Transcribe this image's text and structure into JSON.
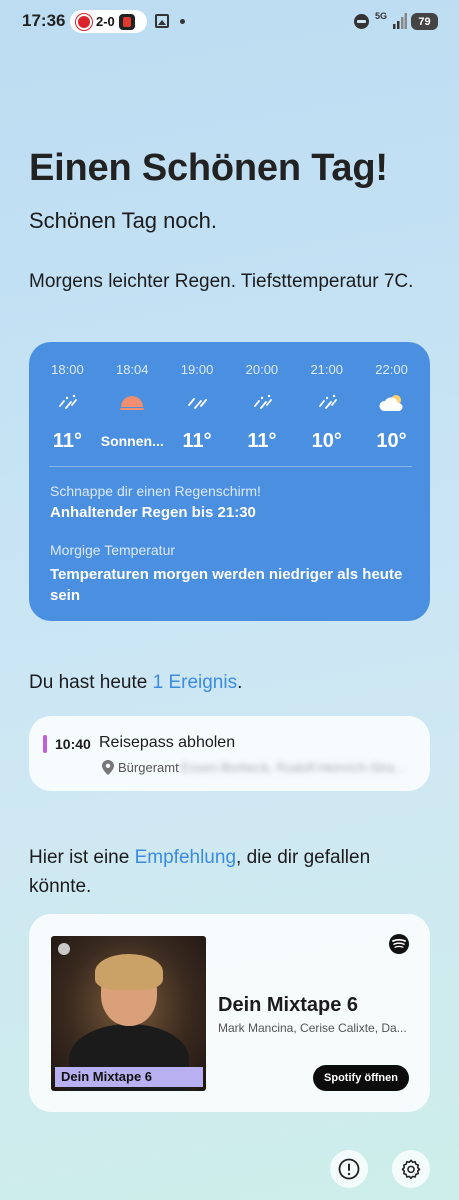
{
  "status_bar": {
    "time": "17:36",
    "score": "2-0",
    "network": "5G",
    "battery": "79"
  },
  "greeting": {
    "headline": "Einen Schönen Tag!",
    "subline": "Schönen Tag noch."
  },
  "weather": {
    "summary": "Morgens leichter Regen. Tiefsttemperatur 7C.",
    "forecast": [
      {
        "time": "18:00",
        "icon": "rain-icon",
        "temp": "11°"
      },
      {
        "time": "18:04",
        "icon": "sunset-icon",
        "temp": "Sonnen..."
      },
      {
        "time": "19:00",
        "icon": "rain-icon",
        "temp": "11°"
      },
      {
        "time": "20:00",
        "icon": "rain-icon",
        "temp": "11°"
      },
      {
        "time": "21:00",
        "icon": "rain-icon",
        "temp": "10°"
      },
      {
        "time": "22:00",
        "icon": "cloud-icon",
        "temp": "10°"
      }
    ],
    "tip_label": "Schnappe dir einen Regenschirm!",
    "tip_value": "Anhaltender Regen bis 21:30",
    "temp_label": "Morgige Temperatur",
    "temp_value": "Temperaturen morgen werden niedriger als heute sein",
    "card_color": "#4b8fe0"
  },
  "events": {
    "intro_prefix": "Du hast heute ",
    "intro_link": "1 Ereignis",
    "intro_suffix": ".",
    "items": [
      {
        "time": "10:40",
        "title": "Reisepass abholen",
        "location": "Bürgeramt",
        "location_detail": "Essen-Borbeck, Rudolf-Heinrich-Stra..."
      }
    ],
    "accent_color": "#c35de0"
  },
  "recommendation": {
    "intro_prefix": "Hier ist eine ",
    "intro_link": "Empfehlung",
    "intro_suffix": ", die dir gefallen könnte.",
    "cover_label": "Dein Mixtape 6",
    "title": "Dein Mixtape 6",
    "artists": "Mark Mancina, Cerise Calixte, Da...",
    "button_label": "Spotify öffnen"
  },
  "colors": {
    "link": "#3b8be0"
  }
}
